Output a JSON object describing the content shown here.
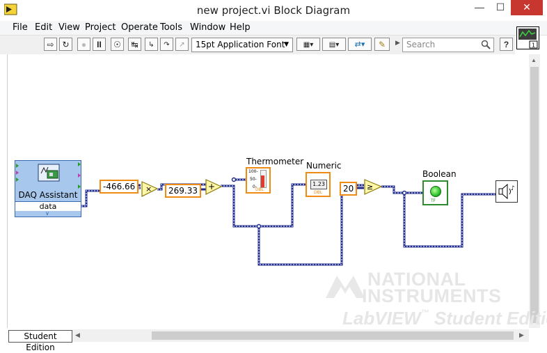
{
  "window": {
    "title": "new project.vi Block Diagram"
  },
  "menu": [
    "File",
    "Edit",
    "View",
    "Project",
    "Operate",
    "Tools",
    "Window",
    "Help"
  ],
  "toolbar": {
    "font": "15pt Application Font",
    "search_placeholder": "Search",
    "help": "?"
  },
  "diagram": {
    "daq_label": "DAQ Assistant",
    "daq_output": "data",
    "const_multiplier": "-466.66",
    "const_offset": "269.33",
    "thermometer_label": "Thermometer",
    "thermometer_type": "DBL",
    "thermometer_scale": [
      "100-",
      "50-",
      "0-"
    ],
    "numeric_label": "Numeric",
    "numeric_value": "1.23",
    "numeric_type": "DBL",
    "compare_const": "20",
    "boolean_label": "Boolean",
    "boolean_tf": "TF"
  },
  "status": {
    "edition": "Student Edition"
  },
  "watermark": {
    "line1": "NATIONAL",
    "line2": "INSTRUMENTS",
    "line3": "LabVIEW",
    "tm": "™",
    "line4": "Student Edition"
  },
  "colors": {
    "wire": "#1d2a8c",
    "constant_border": "#ef8a13",
    "daq_fill": "#a7c8ec",
    "led": "#3fd13f"
  }
}
